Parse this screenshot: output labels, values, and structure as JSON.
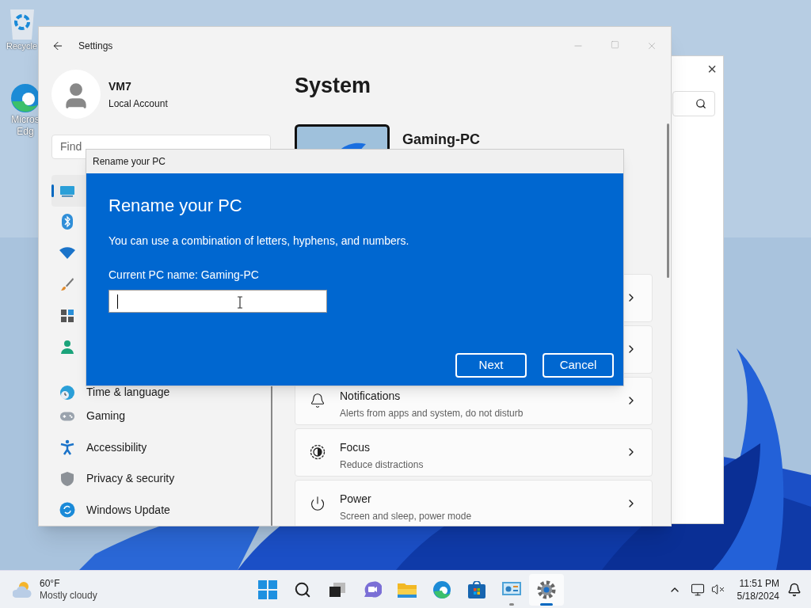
{
  "desktop_icons": [
    {
      "label": "Recycle"
    },
    {
      "label": "Micros Edg"
    }
  ],
  "back_window": {
    "close": "×"
  },
  "settings": {
    "title": "Settings",
    "account": {
      "name": "VM7",
      "type": "Local Account"
    },
    "search": {
      "placeholder": "Find"
    },
    "nav": [
      {
        "selected": true
      },
      {
        "selected": false
      },
      {
        "selected": false
      },
      {
        "selected": false
      },
      {
        "selected": false
      },
      {
        "selected": false
      },
      {
        "label": "Time & language",
        "selected": false
      },
      {
        "label": "Gaming",
        "selected": false
      },
      {
        "label": "Accessibility",
        "selected": false
      },
      {
        "label": "Privacy & security",
        "selected": false
      },
      {
        "label": "Windows Update",
        "selected": false
      }
    ],
    "heading": "System",
    "pc_name": "Gaming-PC",
    "cards": [
      {
        "kind": "covered"
      },
      {
        "kind": "covered"
      },
      {
        "kind": "item",
        "title": "Notifications",
        "subtitle": "Alerts from apps and system, do not disturb"
      },
      {
        "kind": "item",
        "title": "Focus",
        "subtitle": "Reduce distractions"
      },
      {
        "kind": "item",
        "title": "Power",
        "subtitle": "Screen and sleep, power mode"
      }
    ]
  },
  "dialog": {
    "title": "Rename your PC",
    "heading": "Rename your PC",
    "text": "You can use a combination of letters, hyphens, and numbers.",
    "current": "Current PC name: Gaming-PC",
    "buttons": [
      "Next",
      "Cancel"
    ]
  },
  "taskbar": {
    "weather": {
      "temp": "60°F",
      "condition": "Mostly cloudy"
    },
    "apps": [
      {
        "running": false,
        "active": false
      },
      {
        "running": false,
        "active": false
      },
      {
        "running": false,
        "active": false
      },
      {
        "running": false,
        "active": false
      },
      {
        "running": false,
        "active": false
      },
      {
        "running": false,
        "active": false
      },
      {
        "running": false,
        "active": false
      },
      {
        "running": true,
        "active": false
      },
      {
        "running": true,
        "active": true
      }
    ],
    "time": "11:51 PM",
    "date": "5/18/2024"
  }
}
